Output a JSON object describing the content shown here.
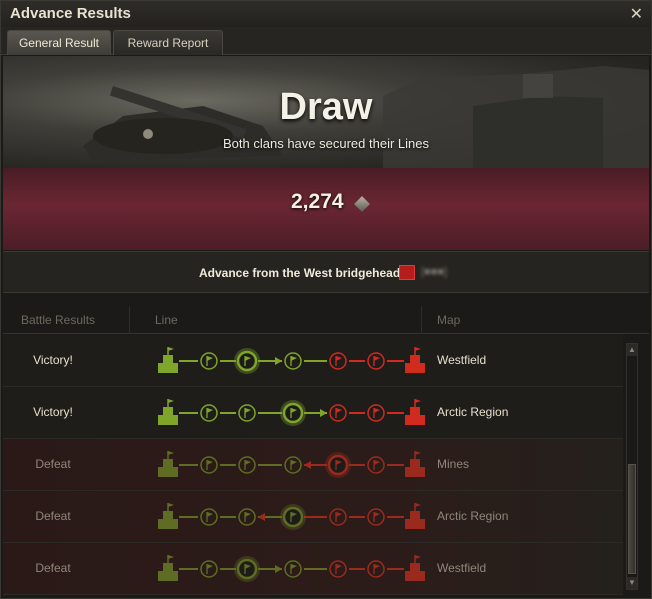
{
  "window": {
    "title": "Advance Results",
    "close_icon": "close-icon"
  },
  "tabs": [
    {
      "label": "General Result",
      "active": true
    },
    {
      "label": "Reward Report",
      "active": false
    }
  ],
  "hero": {
    "outcome": "Draw",
    "subtitle": "Both clans have secured their Lines"
  },
  "reward": {
    "value": "2,274",
    "icon": "industrial-resource-icon"
  },
  "advance": {
    "text": "Advance from the West bridgehead"
  },
  "table": {
    "headers": {
      "battle_results": "Battle Results",
      "line": "Line",
      "map": "Map"
    },
    "rows": [
      {
        "result": "Victory!",
        "map": "Westfield",
        "type": "victory",
        "active_index": 2,
        "direction": "right"
      },
      {
        "result": "Victory!",
        "map": "Arctic Region",
        "type": "victory",
        "active_index": 3,
        "direction": "right"
      },
      {
        "result": "Defeat",
        "map": "Mines",
        "type": "defeat",
        "active_index": 4,
        "direction": "left"
      },
      {
        "result": "Defeat",
        "map": "Arctic Region",
        "type": "defeat",
        "active_index": 3,
        "direction": "left"
      },
      {
        "result": "Defeat",
        "map": "Westfield",
        "type": "defeat",
        "active_index": 2,
        "direction": "right"
      }
    ]
  },
  "colors": {
    "green": "#7fa52a",
    "red": "#d12a1f",
    "defeat_green": "#5f6c24",
    "defeat_red": "#9a2a1d"
  }
}
